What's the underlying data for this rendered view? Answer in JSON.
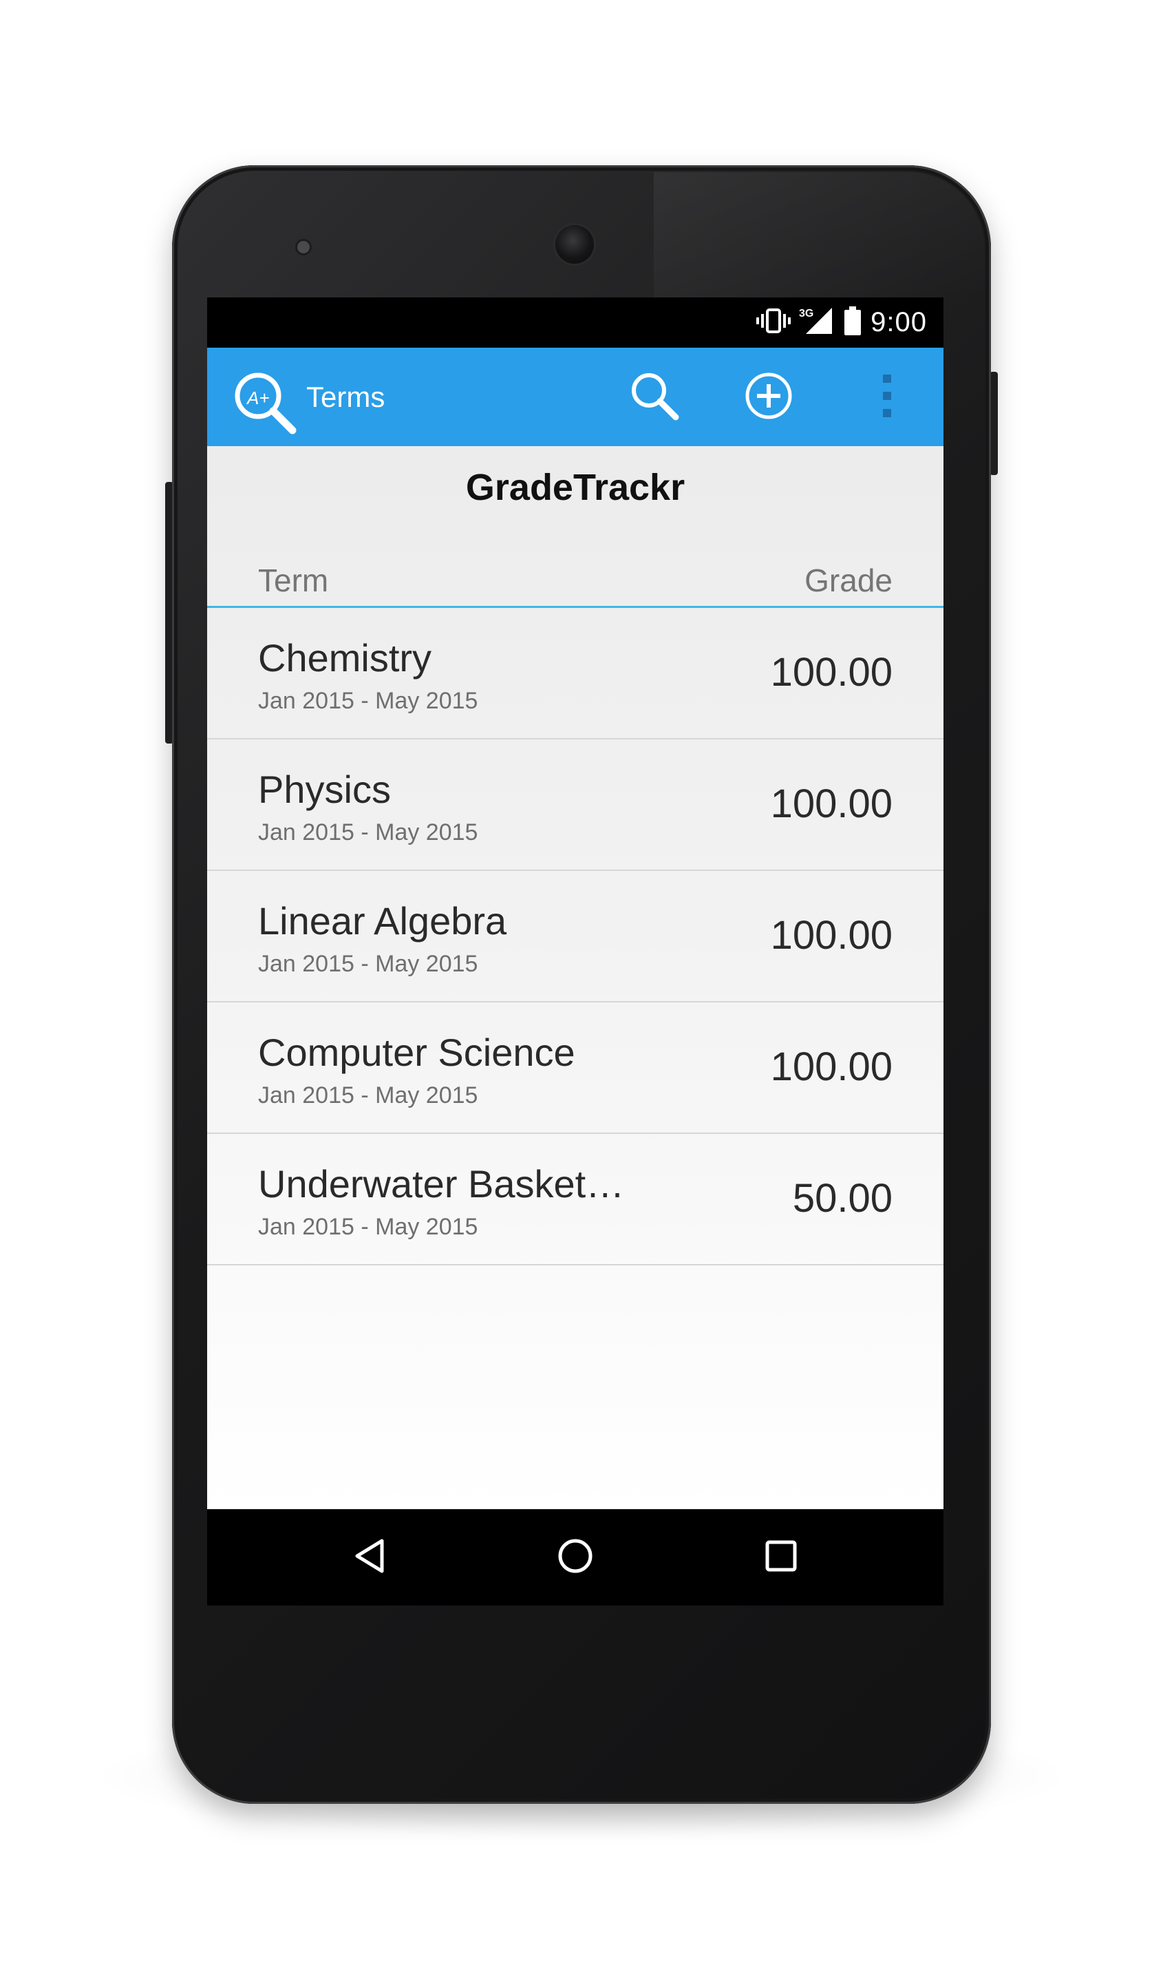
{
  "status_bar": {
    "time": "9:00",
    "network_label": "3G",
    "icons": [
      "vibrate-icon",
      "signal-3g-icon",
      "battery-icon"
    ]
  },
  "action_bar": {
    "title": "Terms",
    "background_color": "#2a9ee8",
    "app_icon": "app-logo-magnifier-aplus-icon",
    "app_icon_text": "A+",
    "actions": [
      "search-icon",
      "add-circle-icon",
      "overflow-menu-icon"
    ]
  },
  "main": {
    "heading": "GradeTrackr",
    "columns": {
      "term": "Term",
      "grade": "Grade"
    },
    "accent_color": "#41b6e6",
    "terms": [
      {
        "name": "Chemistry",
        "dates": "Jan 2015 - May 2015",
        "grade": "100.00"
      },
      {
        "name": "Physics",
        "dates": "Jan 2015 - May 2015",
        "grade": "100.00"
      },
      {
        "name": "Linear Algebra",
        "dates": "Jan 2015 - May 2015",
        "grade": "100.00"
      },
      {
        "name": "Computer Science",
        "dates": "Jan 2015 - May 2015",
        "grade": "100.00"
      },
      {
        "name": "Underwater Basket…",
        "dates": "Jan 2015 - May 2015",
        "grade": "50.00"
      }
    ]
  },
  "nav_bar": {
    "buttons": [
      "back-icon",
      "home-icon",
      "recents-icon"
    ]
  }
}
